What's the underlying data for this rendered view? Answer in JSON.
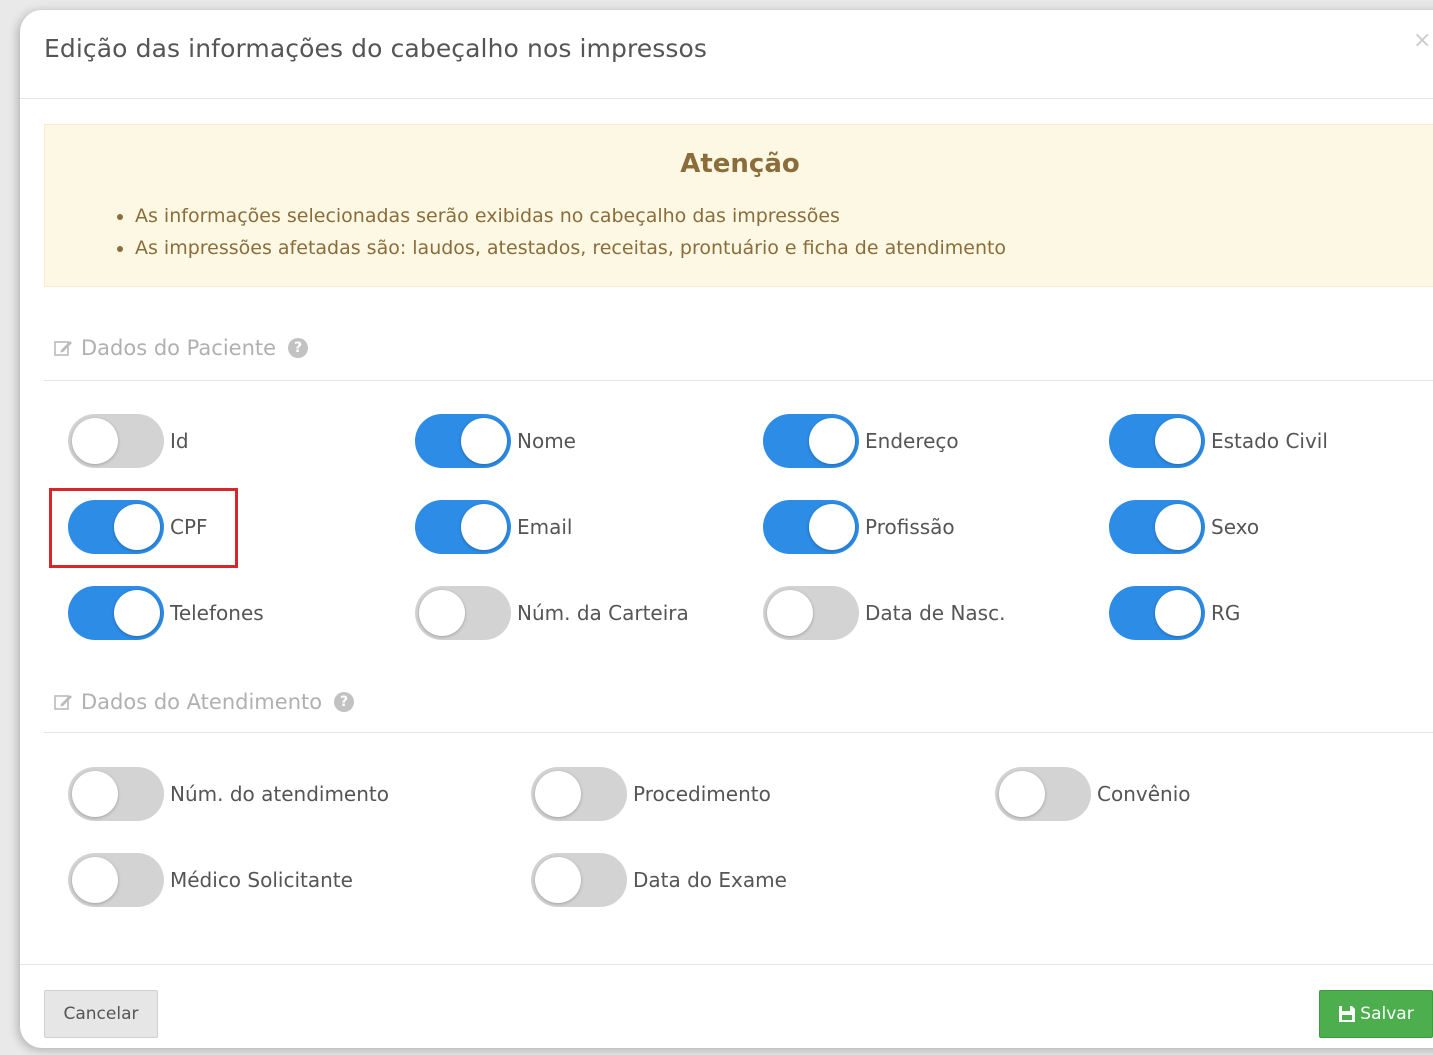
{
  "modal": {
    "title": "Edição das informações do cabeçalho nos impressos",
    "close_glyph": "×"
  },
  "alert": {
    "title": "Atenção",
    "items": [
      "As informações selecionadas serão exibidas no cabeçalho das impressões",
      "As impressões afetadas são: laudos, atestados, receitas, prontuário e ficha de atendimento"
    ]
  },
  "patient_section": {
    "title": "Dados do Paciente",
    "toggles": [
      {
        "label": "Id",
        "on": false
      },
      {
        "label": "Nome",
        "on": true
      },
      {
        "label": "Endereço",
        "on": true
      },
      {
        "label": "Estado Civil",
        "on": true
      },
      {
        "label": "CPF",
        "on": true
      },
      {
        "label": "Email",
        "on": true
      },
      {
        "label": "Profissão",
        "on": true
      },
      {
        "label": "Sexo",
        "on": true
      },
      {
        "label": "Telefones",
        "on": true
      },
      {
        "label": "Núm. da Carteira",
        "on": false
      },
      {
        "label": "Data de Nasc.",
        "on": false
      },
      {
        "label": "RG",
        "on": true
      }
    ]
  },
  "appointment_section": {
    "title": "Dados do Atendimento",
    "toggles": [
      {
        "label": "Núm. do atendimento",
        "on": false
      },
      {
        "label": "Procedimento",
        "on": false
      },
      {
        "label": "Convênio",
        "on": false
      },
      {
        "label": "Médico Solicitante",
        "on": false
      },
      {
        "label": "Data do Exame",
        "on": false
      }
    ]
  },
  "footer": {
    "cancel_label": "Cancelar",
    "save_label": "Salvar"
  },
  "colors": {
    "toggle_on": "#2d8ce6",
    "toggle_off": "#d3d3d3",
    "save_button": "#4cae4c",
    "alert_background": "#fcf8e3",
    "alert_text": "#8a6d3b",
    "highlight": "#d9262b"
  },
  "icons": {
    "section": "edit-icon",
    "help": "help-icon",
    "save": "floppy-disk-icon",
    "close": "close-icon"
  }
}
